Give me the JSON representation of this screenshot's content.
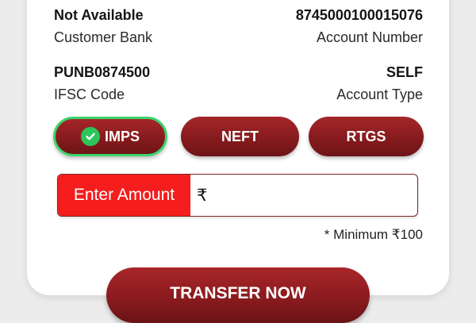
{
  "beneficiary": {
    "customer_bank_value": "Not Available",
    "customer_bank_label": "Customer Bank",
    "account_number_value": "8745000100015076",
    "account_number_label": "Account Number",
    "ifsc_value": "PUNB0874500",
    "ifsc_label": "IFSC Code",
    "account_type_value": "SELF",
    "account_type_label": "Account Type"
  },
  "transfer_modes": {
    "imps": "IMPS",
    "neft": "NEFT",
    "rtgs": "RTGS",
    "selected": "IMPS",
    "selected_icon": "check-icon"
  },
  "amount": {
    "label": "Enter Amount",
    "currency_symbol": "₹",
    "value": "",
    "minimum_note": "* Minimum ₹100"
  },
  "actions": {
    "transfer_label": "TRANSFER NOW"
  },
  "colors": {
    "brand_maroon": "#8a1b1e",
    "label_red": "#f51d1d",
    "active_green": "#2cc55a"
  }
}
